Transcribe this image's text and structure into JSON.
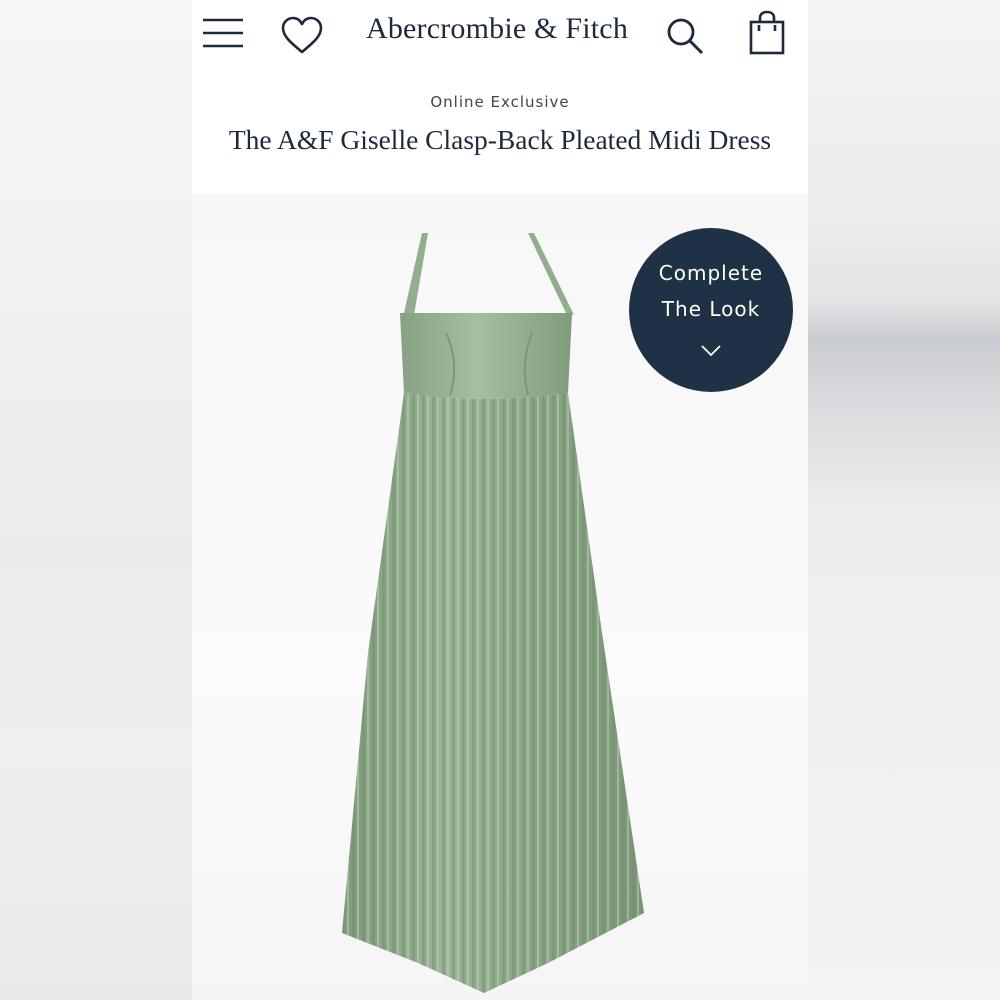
{
  "header": {
    "brand": "Abercrombie & Fitch",
    "menu_icon": "hamburger-menu-icon",
    "wishlist_icon": "heart-icon",
    "search_icon": "search-icon",
    "bag_icon": "shopping-bag-icon"
  },
  "product": {
    "eyebrow": "Online Exclusive",
    "title": "The A&F Giselle Clasp-Back Pleated Midi Dress",
    "image_alt": "green pleated midi dress"
  },
  "complete_look": {
    "line1": "Complete",
    "line2": "The Look",
    "icon": "chevron-down-icon"
  },
  "colors": {
    "navy": "#1f3245",
    "dress_green": "#8fab8d"
  }
}
